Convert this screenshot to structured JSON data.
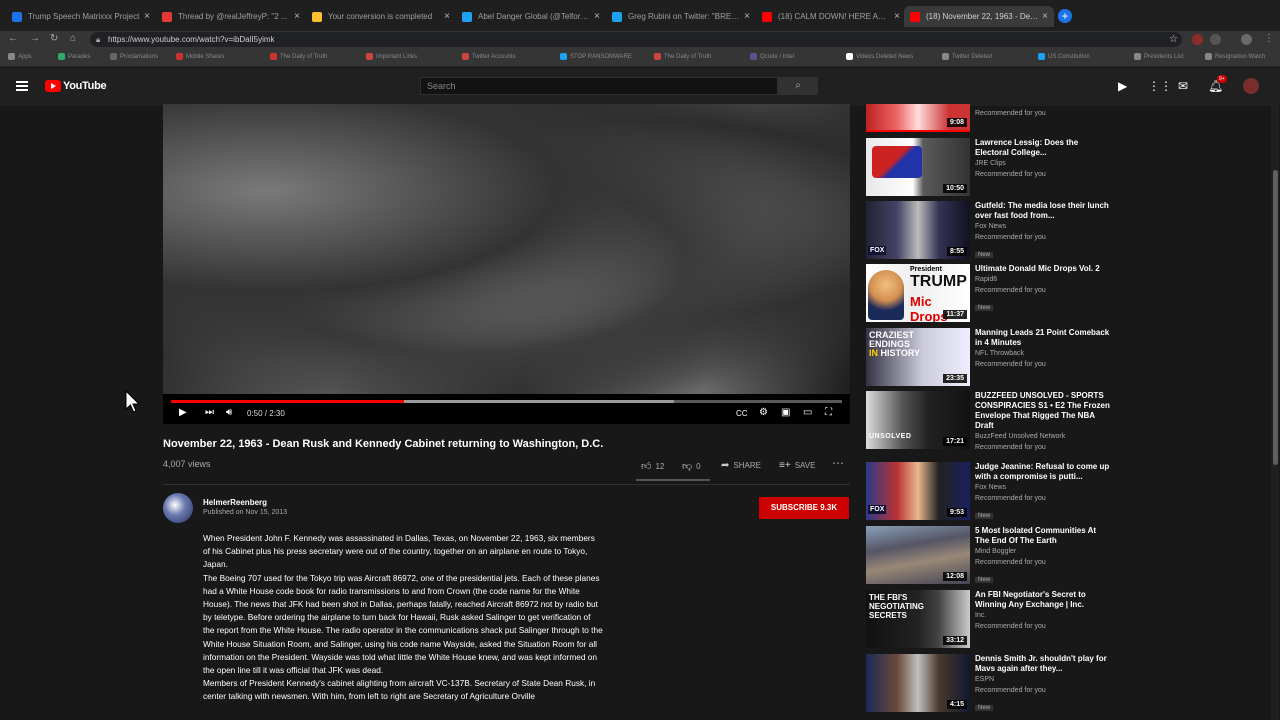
{
  "browser": {
    "tabs": [
      {
        "label": "Trump Speech Matrixxx Project",
        "color": "#1a73e8"
      },
      {
        "label": "Thread by @realJeffreyP: \"2 ...",
        "color": "#e53935"
      },
      {
        "label": "Your conversion is completed",
        "color": "#fbc02d"
      },
      {
        "label": "Abel Danger Global (@Telford...",
        "color": "#1da1f2"
      },
      {
        "label": "Greg Rubini on Twitter: \"BREAK...",
        "color": "#1da1f2"
      },
      {
        "label": "(18) CALM DOWN! HERE ARE ...",
        "color": "#ff0000"
      },
      {
        "label": "(18) November 22, 1963 - Dea...",
        "color": "#ff0000"
      }
    ],
    "url": "https://www.youtube.com/watch?v=ibDalI5yimk",
    "bookmarks": [
      "Apps",
      "Parades",
      "Proclamations",
      "Mobile Shares",
      "The Daily of Truth",
      "Important Links",
      "Twitter Accounts",
      "STOP RANSOMWARE",
      "The Daily of Truth",
      "Qcode / Intel",
      "Videos Deleted News",
      "Twitter Deleted",
      "US Constitution",
      "Presidents List",
      "Resignation Watch"
    ]
  },
  "youtube": {
    "brand": "YouTube",
    "search_placeholder": "Search",
    "notification_count": "9+",
    "accent": "#ff0000"
  },
  "player": {
    "progress": 0.3467,
    "buffered": 0.75,
    "current_time": "0:50",
    "duration": "2:30",
    "time_display": "0:50 / 2:30"
  },
  "video": {
    "title": "November 22, 1963 - Dean Rusk and Kennedy Cabinet returning to Washington, D.C.",
    "views": "4,007 views",
    "likes": "12",
    "dislikes": "0",
    "share_label": "SHARE",
    "save_label": "SAVE",
    "channel": "HelmerReenberg",
    "published": "Published on Nov 15, 2013",
    "subscribe_label": "SUBSCRIBE 9.3K",
    "description": [
      "When President John F. Kennedy was assassinated in Dallas, Texas, on November 22, 1963, six members of his Cabinet plus his press secretary were out of the country, together on an airplane en route to Tokyo, Japan.",
      "The Boeing 707 used for the Tokyo trip was Aircraft 86972, one of the presidential jets. Each of these planes had a White House code book for radio transmissions to and from Crown (the code name for the White House).  The news that JFK had been shot in Dallas, perhaps fatally, reached Aircraft 86972 not by radio but by teletype. Before ordering the airplane to turn back for Hawaii, Rusk asked Salinger to get verification of the report from the White House. The radio operator in the communications shack put Salinger through to the White House Situation Room, and Salinger, using his code name Wayside, asked the Situation Room for all information on the President. Wayside was told what little the White House knew, and was kept informed on the open line till it was official that JFK was dead.",
      "Members of President Kennedy's cabinet alighting from aircraft VC-137B. Secretary of State Dean Rusk, in center talking with newsmen. With him, from left to right are Secretary of Agriculture Orville"
    ]
  },
  "recommendations": [
    {
      "title": "",
      "channel": "",
      "meta": "Recommended for you",
      "duration": "9:08",
      "new": false
    },
    {
      "title": "Lawrence Lessig: Does the Electoral College...",
      "channel": "JRE Clips",
      "meta": "Recommended for you",
      "duration": "10:50",
      "new": false
    },
    {
      "title": "Gutfeld: The media lose their lunch over fast food from...",
      "channel": "Fox News",
      "meta": "Recommended for you",
      "duration": "8:55",
      "new": true
    },
    {
      "title": "Ultimate Donald Mic Drops Vol. 2",
      "channel": "Rapid6",
      "meta": "Recommended for you",
      "duration": "11:37",
      "new": true,
      "thumb_text": "President TRUMP Mic Drops"
    },
    {
      "title": "Manning Leads 21 Point Comeback in 4 Minutes",
      "channel": "NFL Throwback",
      "meta": "Recommended for you",
      "duration": "23:35",
      "new": false,
      "thumb_text": "CRAZIEST ENDINGS IN HISTORY"
    },
    {
      "title": "BUZZFEED UNSOLVED - SPORTS CONSPIRACIES  S1 • E2 The Frozen Envelope That Rigged The NBA Draft",
      "channel": "BuzzFeed Unsolved Network",
      "meta": "Recommended for you",
      "duration": "17:21",
      "new": false,
      "thumb_text": "UNSOLVED"
    },
    {
      "title": "Judge Jeanine: Refusal to come up with a compromise is putti...",
      "channel": "Fox News",
      "meta": "Recommended for you",
      "duration": "9:53",
      "new": true
    },
    {
      "title": "5 Most Isolated Communities At The End Of The Earth",
      "channel": "Mind Boggler",
      "meta": "Recommended for you",
      "duration": "12:08",
      "new": true
    },
    {
      "title": "An FBI Negotiator's Secret to Winning Any Exchange | Inc.",
      "channel": "Inc.",
      "meta": "Recommended for you",
      "duration": "33:12",
      "new": false,
      "thumb_text": "THE FBI'S NEGOTIATING SECRETS"
    },
    {
      "title": "Dennis Smith Jr. shouldn't play for Mavs again after they...",
      "channel": "ESPN",
      "meta": "Recommended for you",
      "duration": "4:15",
      "new": true
    }
  ]
}
